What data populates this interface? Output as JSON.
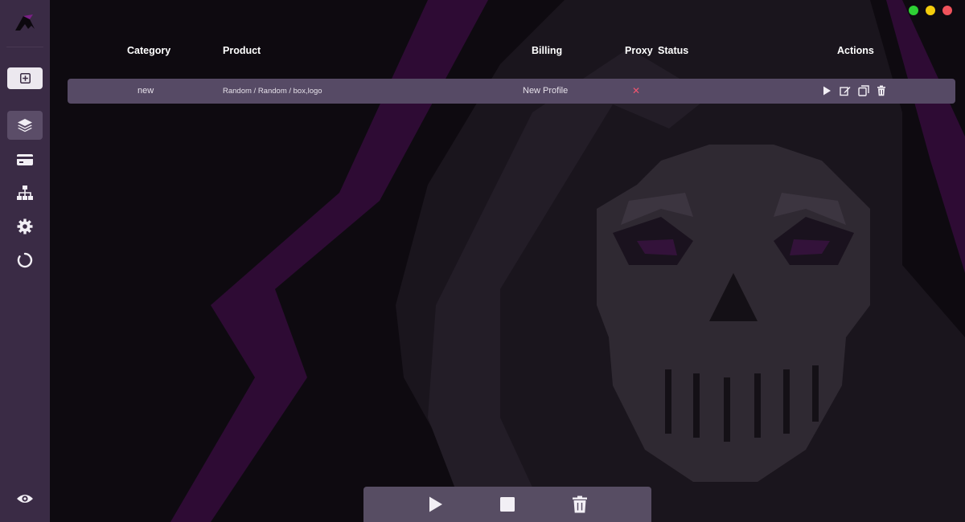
{
  "window_controls": [
    "maximize",
    "minimize",
    "close"
  ],
  "sidebar": {
    "items": [
      {
        "name": "new-task",
        "icon": "plus-square-icon"
      },
      {
        "name": "tasks",
        "icon": "layers-icon",
        "active": true
      },
      {
        "name": "billing",
        "icon": "credit-card-icon"
      },
      {
        "name": "proxies",
        "icon": "network-icon"
      },
      {
        "name": "settings",
        "icon": "gear-icon"
      },
      {
        "name": "loading",
        "icon": "spinner-icon"
      }
    ],
    "footer_icon": "eye-icon"
  },
  "table": {
    "headers": {
      "category": "Category",
      "product": "Product",
      "billing": "Billing",
      "proxy": "Proxy",
      "status": "Status",
      "actions": "Actions"
    },
    "rows": [
      {
        "category": "new",
        "product": "Random / Random / box,logo",
        "billing": "New Profile",
        "proxy_icon": "x-icon",
        "proxy": "✕",
        "status": "",
        "actions": [
          "play-icon",
          "edit-icon",
          "copy-icon",
          "trash-icon"
        ]
      }
    ]
  },
  "bottom_bar": {
    "actions": [
      "play-all-icon",
      "stop-all-icon",
      "delete-all-icon"
    ]
  },
  "colors": {
    "sidebar": "#3a2b45",
    "row": "#564a65",
    "accent_purple": "#3b0c42",
    "error": "#f05570"
  }
}
